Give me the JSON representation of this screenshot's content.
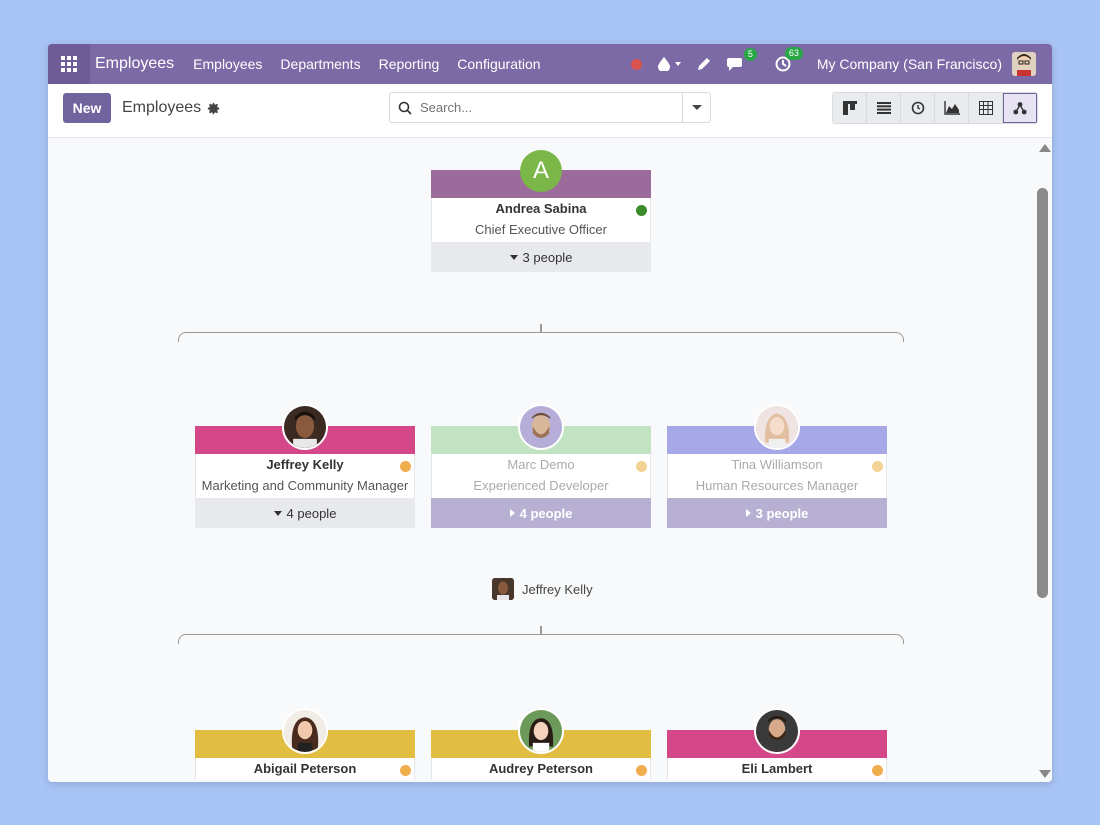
{
  "navbar": {
    "brand": "Employees",
    "menu": [
      "Employees",
      "Departments",
      "Reporting",
      "Configuration"
    ],
    "messages_badge": "5",
    "activities_badge": "63",
    "company": "My Company (San Francisco)"
  },
  "control_panel": {
    "new_label": "New",
    "title": "Employees",
    "search_placeholder": "Search..."
  },
  "org": {
    "root": {
      "name": "Andrea Sabina",
      "job": "Chief Executive Officer",
      "initial": "A",
      "people": "3 people",
      "band_color": "#9b6b9b",
      "status_color": "#3a8d2a"
    },
    "level1": [
      {
        "name": "Jeffrey Kelly",
        "job": "Marketing and Community Manager",
        "people": "4 people",
        "band_color": "#d4488a",
        "status_color": "#f0ad4e",
        "faded": false
      },
      {
        "name": "Marc Demo",
        "job": "Experienced Developer",
        "people": "4 people",
        "band_color": "#c2e3c2",
        "status_color": "#f3d394",
        "faded": true
      },
      {
        "name": "Tina Williamson",
        "job": "Human Resources Manager",
        "people": "3 people",
        "band_color": "#a7a8e8",
        "status_color": "#f3d394",
        "faded": true
      }
    ],
    "crumb_name": "Jeffrey Kelly",
    "level2": [
      {
        "name": "Abigail Peterson",
        "band_color": "#e1bd42",
        "status_color": "#f0ad4e"
      },
      {
        "name": "Audrey Peterson",
        "band_color": "#e1bd42",
        "status_color": "#f0ad4e"
      },
      {
        "name": "Eli Lambert",
        "band_color": "#d4488a",
        "status_color": "#f0ad4e"
      }
    ]
  }
}
